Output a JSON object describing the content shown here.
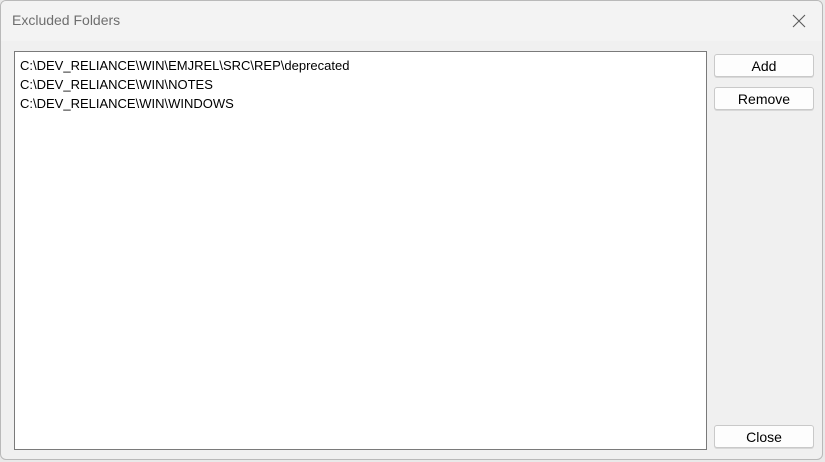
{
  "window": {
    "title": "Excluded Folders",
    "close_icon": "close-icon"
  },
  "folders": {
    "items": [
      "C:\\DEV_RELIANCE\\WIN\\EMJREL\\SRC\\REP\\deprecated",
      "C:\\DEV_RELIANCE\\WIN\\NOTES",
      "C:\\DEV_RELIANCE\\WIN\\WINDOWS"
    ]
  },
  "buttons": {
    "add_label": "Add",
    "remove_label": "Remove",
    "close_label": "Close"
  }
}
